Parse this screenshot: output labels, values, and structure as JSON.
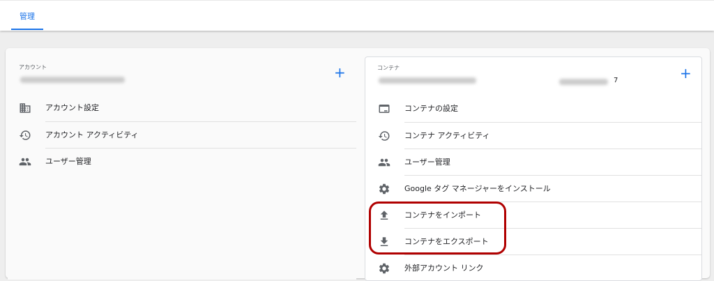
{
  "tabs": [
    {
      "label": "管理"
    }
  ],
  "account": {
    "section_label": "アカウント",
    "items": [
      {
        "label": "アカウント設定",
        "icon": "building-icon"
      },
      {
        "label": "アカウント アクティビティ",
        "icon": "history-icon"
      },
      {
        "label": "ユーザー管理",
        "icon": "people-icon"
      }
    ]
  },
  "container": {
    "section_label": "コンテナ",
    "id_suffix": "7",
    "items": [
      {
        "label": "コンテナの設定",
        "icon": "container-settings-icon"
      },
      {
        "label": "コンテナ アクティビティ",
        "icon": "history-icon"
      },
      {
        "label": "ユーザー管理",
        "icon": "people-icon"
      },
      {
        "label": "Google タグ マネージャーをインストール",
        "icon": "gear-icon"
      },
      {
        "label": "コンテナをインポート",
        "icon": "upload-icon"
      },
      {
        "label": "コンテナをエクスポート",
        "icon": "download-icon"
      },
      {
        "label": "外部アカウント リンク",
        "icon": "gear-icon"
      }
    ]
  },
  "colors": {
    "accent": "#1a73e8",
    "highlight": "#b00000",
    "icon": "#5f6368"
  }
}
